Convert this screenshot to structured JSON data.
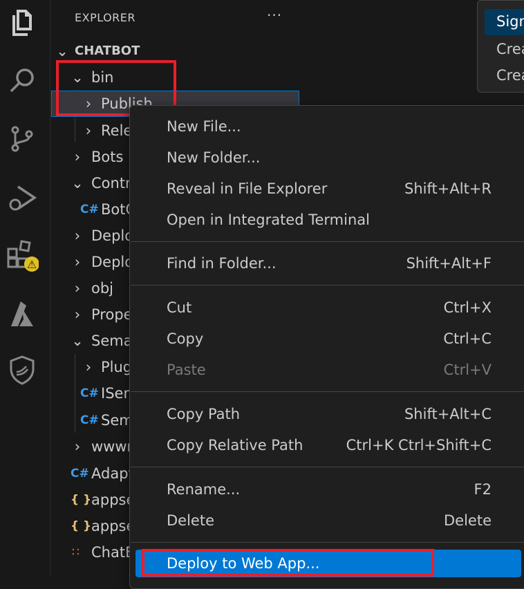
{
  "sidebar": {
    "title": "EXPLORER",
    "more": "···",
    "root": "CHATBOT",
    "items": [
      {
        "label": "bin"
      },
      {
        "label": "Publish"
      },
      {
        "label": "Rele"
      },
      {
        "label": "Bots"
      },
      {
        "label": "Contr"
      },
      {
        "label": "BotC"
      },
      {
        "label": "Deplo"
      },
      {
        "label": "Deplo"
      },
      {
        "label": "obj"
      },
      {
        "label": "Prope"
      },
      {
        "label": "Sema"
      },
      {
        "label": "Plug"
      },
      {
        "label": "ISem"
      },
      {
        "label": "Sem"
      },
      {
        "label": "wwwr"
      },
      {
        "label": "Adapt"
      },
      {
        "label": "appse"
      },
      {
        "label": "appse"
      },
      {
        "label": "ChatB"
      }
    ],
    "icons": {
      "csharp": "C#",
      "json": "{ }",
      "rss": "∷"
    }
  },
  "popup": {
    "items": [
      "Sign",
      "Crea",
      "Crea"
    ]
  },
  "context_menu": {
    "items": [
      {
        "label": "New File...",
        "shortcut": ""
      },
      {
        "label": "New Folder...",
        "shortcut": ""
      },
      {
        "label": "Reveal in File Explorer",
        "shortcut": "Shift+Alt+R"
      },
      {
        "label": "Open in Integrated Terminal",
        "shortcut": ""
      },
      {
        "label": "Find in Folder...",
        "shortcut": "Shift+Alt+F"
      },
      {
        "label": "Cut",
        "shortcut": "Ctrl+X"
      },
      {
        "label": "Copy",
        "shortcut": "Ctrl+C"
      },
      {
        "label": "Paste",
        "shortcut": "Ctrl+V"
      },
      {
        "label": "Copy Path",
        "shortcut": "Shift+Alt+C"
      },
      {
        "label": "Copy Relative Path",
        "shortcut": "Ctrl+K Ctrl+Shift+C"
      },
      {
        "label": "Rename...",
        "shortcut": "F2"
      },
      {
        "label": "Delete",
        "shortcut": "Delete"
      },
      {
        "label": "Deploy to Web App...",
        "shortcut": ""
      }
    ]
  },
  "colors": {
    "accent": "#0078d4",
    "highlight": "#e8202a",
    "warning": "#e5c07b"
  }
}
